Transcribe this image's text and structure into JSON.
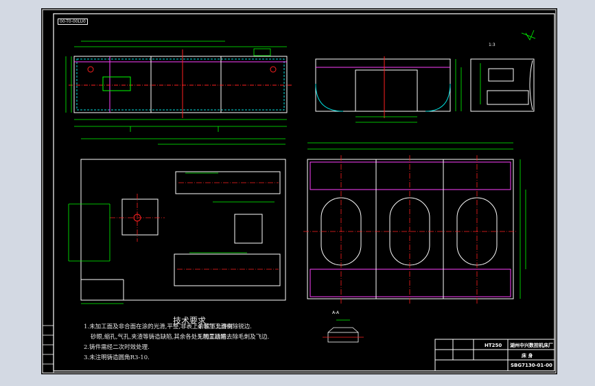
{
  "sheet": {
    "drawing_code_tag": "00-T0-00LU0",
    "scale_label": "1:3",
    "view_label": "A-A"
  },
  "technical_requirements": {
    "title": "技术要求",
    "items": [
      "1.未加工面及非合面在涂的光滑,平整,非表上余留下允许有",
      "砂眼,缩孔,气孔,夹渣等铸造缺陷,其余各处无明显缺陷.",
      "2.铸件需经二次时效处理.",
      "3.未注明铸造圆角R3-10.",
      "4.非加工面倒除锐边.",
      "5.加工后需去除毛刺及飞边."
    ]
  },
  "title_block": {
    "material": "HT250",
    "company": "湖州中兴数控机床厂",
    "part_name": "床 身",
    "drawing_number": "SBG7130-01-00"
  },
  "colors": {
    "paper": "#000000",
    "border": "#ffffff",
    "outline": "#ffffff",
    "dimension": "#00ff00",
    "centerline": "#ff2020",
    "hidden": "#ff40ff",
    "hatch": "#00e0e0",
    "yellow_text": "#ffff00"
  }
}
